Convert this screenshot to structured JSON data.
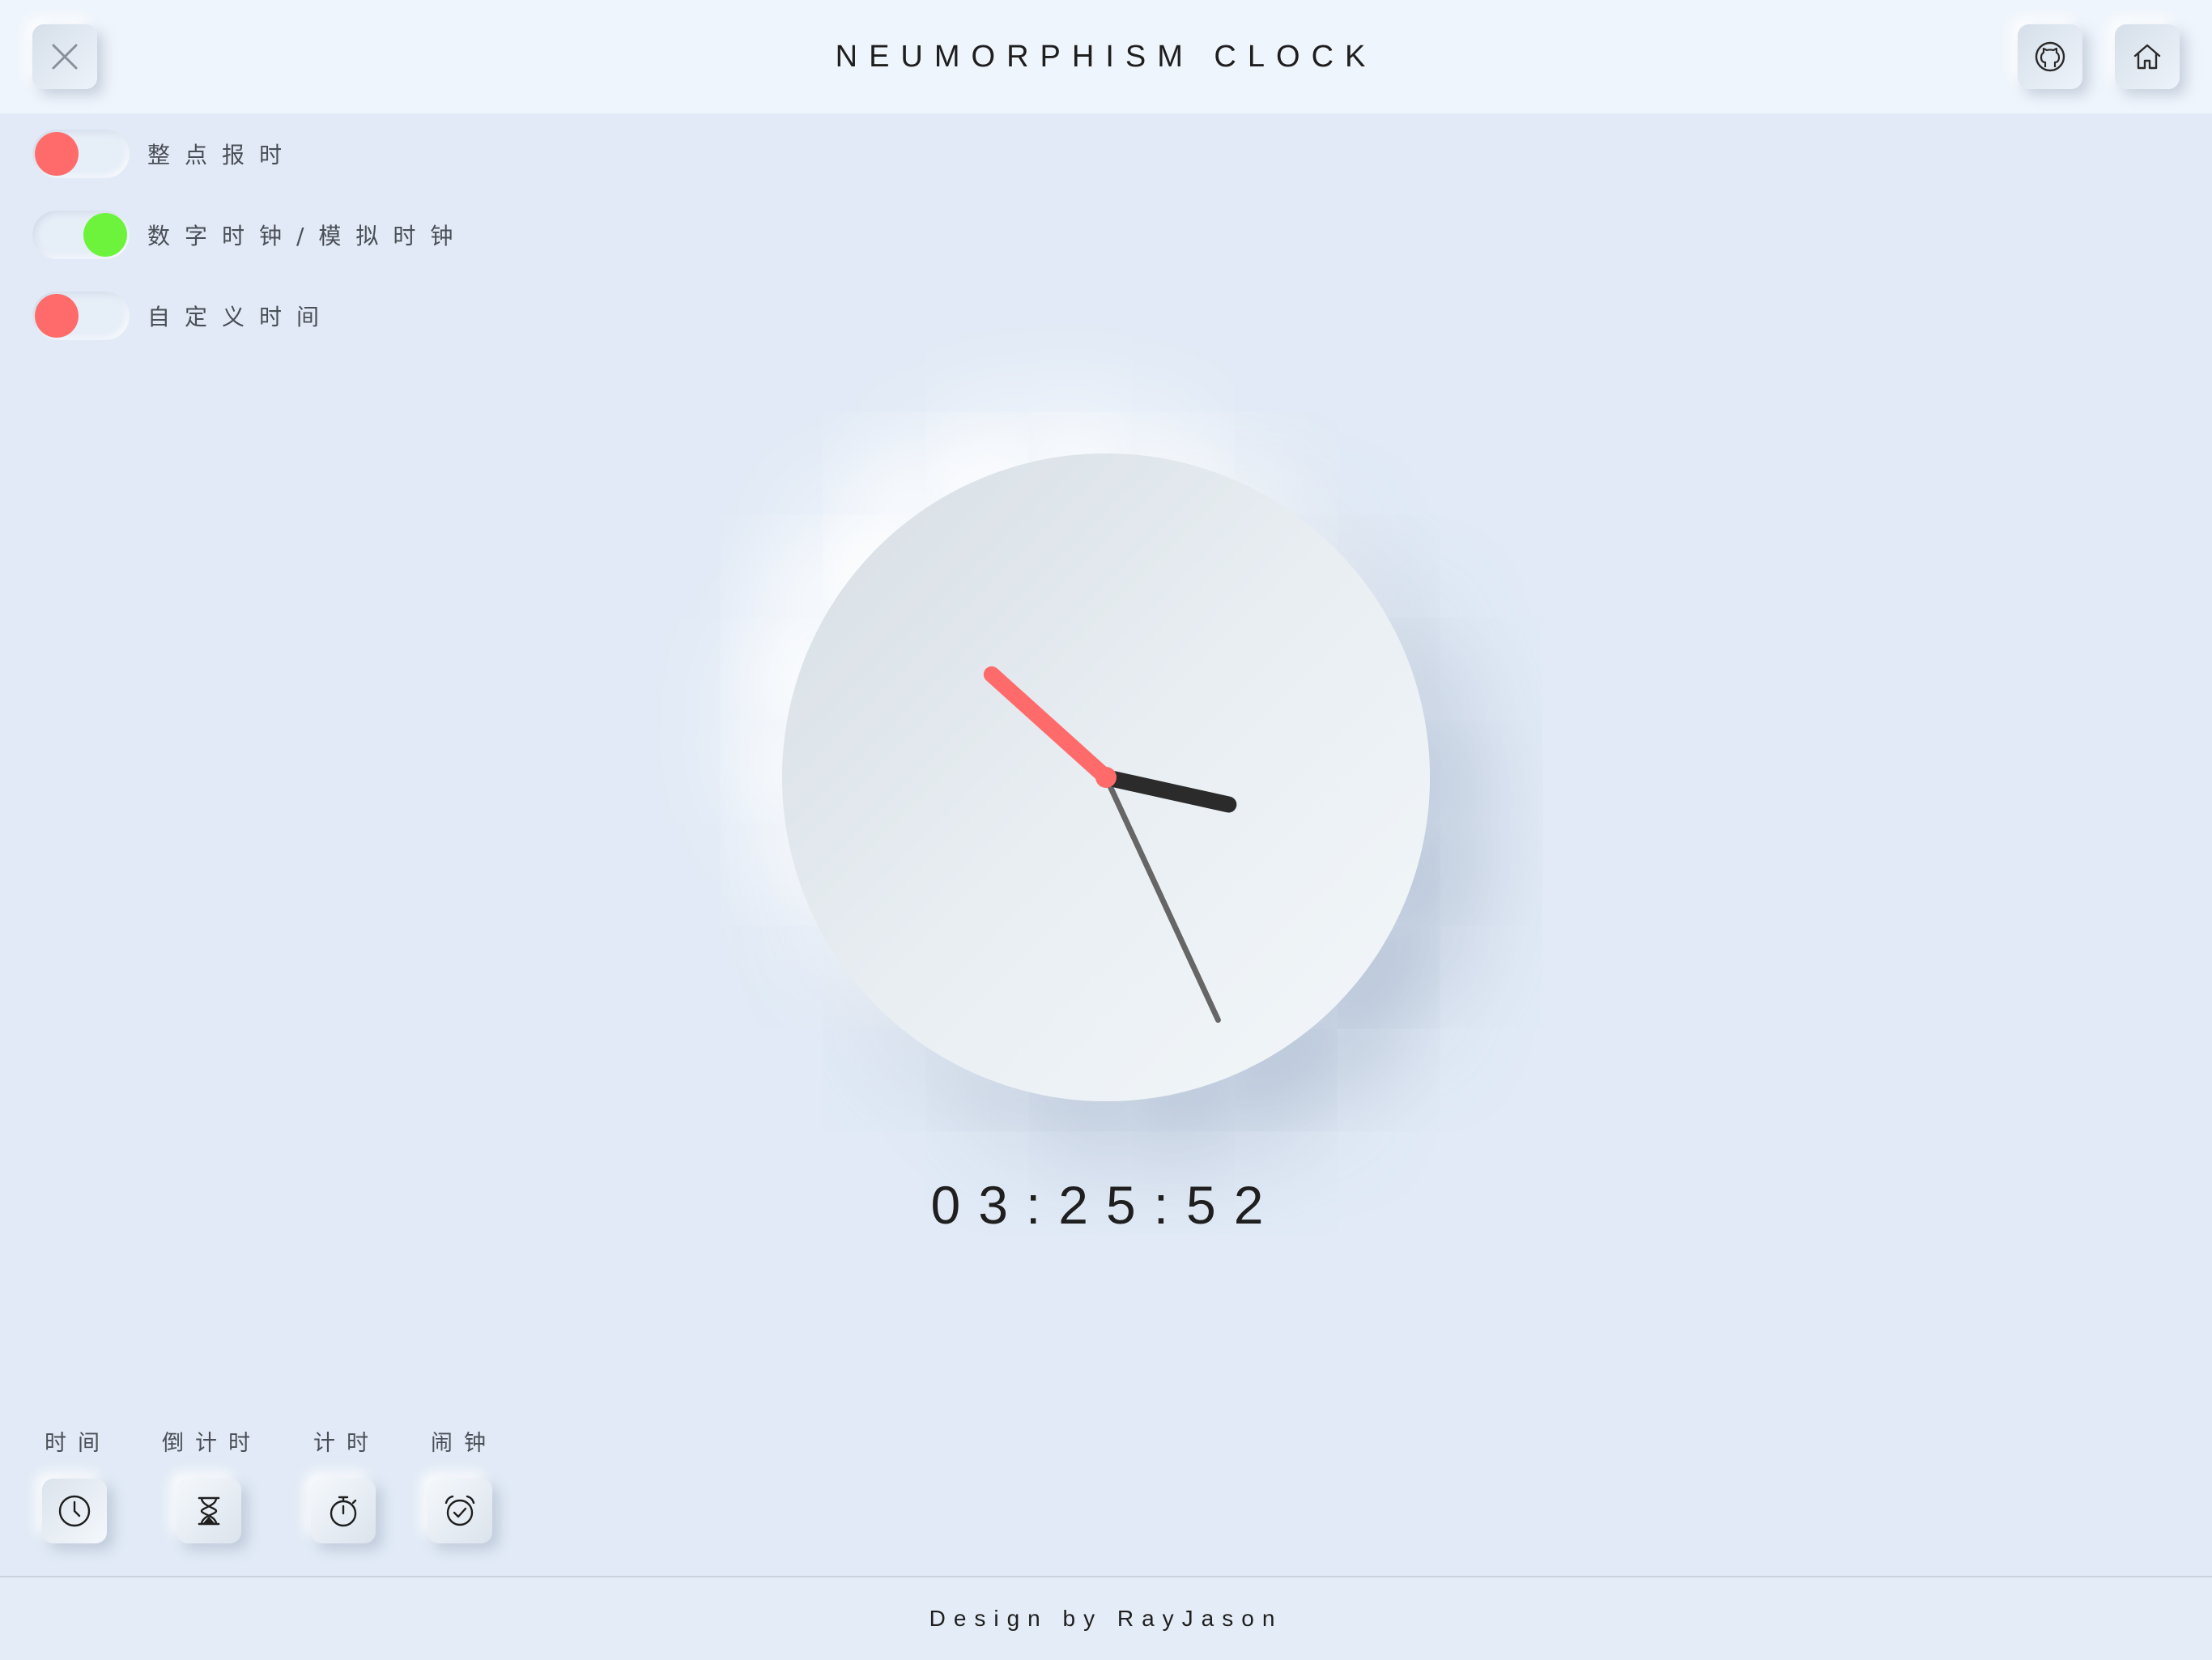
{
  "header": {
    "title": "NEUMORPHISM CLOCK"
  },
  "icons": {
    "close": "close-icon",
    "github": "github-icon",
    "home": "home-icon"
  },
  "settings": [
    {
      "label": "整点报时",
      "on": false
    },
    {
      "label": "数字时钟/模拟时钟",
      "on": true
    },
    {
      "label": "自定义时间",
      "on": false
    }
  ],
  "clock": {
    "time": "03:25:52",
    "hour": 3,
    "minute": 25,
    "second": 52
  },
  "modes": [
    {
      "label": "时间",
      "icon": "clock-icon",
      "active": true
    },
    {
      "label": "倒计时",
      "icon": "hourglass-icon",
      "active": false
    },
    {
      "label": "计时",
      "icon": "stopwatch-icon",
      "active": false
    },
    {
      "label": "闹钟",
      "icon": "alarm-clock-icon",
      "active": false
    }
  ],
  "footer": {
    "text": "Design by RayJason"
  },
  "colors": {
    "background": "#e1eaf6",
    "toggle_off": "#ff6b6b",
    "toggle_on": "#6ef33d",
    "second_hand": "#ff6b6b",
    "hour_hand": "#2b2b2b",
    "minute_hand": "#666666"
  }
}
